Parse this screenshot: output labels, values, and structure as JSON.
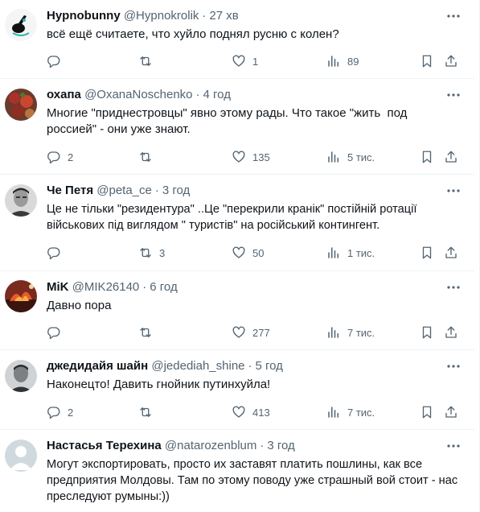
{
  "tweets": [
    {
      "name": "Hypnobunny",
      "handle": "@Hypnokrolik",
      "time": "27 хв",
      "text": "всё ещё считаете, что хуйло поднял русню с колен?",
      "replies": "",
      "retweets": "",
      "likes": "1",
      "views": "89"
    },
    {
      "name": "охапа",
      "handle": "@OxanaNoschenko",
      "time": "4 год",
      "text": "Многие \"приднестровцы\" явно этому рады. Что такое \"жить  под россией\" - они уже знают.",
      "replies": "2",
      "retweets": "",
      "likes": "135",
      "views": "5 тис."
    },
    {
      "name": "Че Петя",
      "handle": "@peta_ce",
      "time": "3 год",
      "text": "Це не тільки \"резидентура\" ..Це \"перекрили кранік\" постійній ротації військових під виглядом \" туристів\" на російський контингент.",
      "replies": "",
      "retweets": "3",
      "likes": "50",
      "views": "1 тис."
    },
    {
      "name": "MiK",
      "handle": "@MIK26140",
      "time": "6 год",
      "text": "Давно пора",
      "replies": "",
      "retweets": "",
      "likes": "277",
      "views": "7 тис."
    },
    {
      "name": "джедидайя шайн",
      "handle": "@jedediah_shine",
      "time": "5 год",
      "text": "Наконецто! Давить гнойник путинхуйла!",
      "replies": "2",
      "retweets": "",
      "likes": "413",
      "views": "7 тис."
    },
    {
      "name": "Настасья Терехина",
      "handle": "@natarozenblum",
      "time": "3 год",
      "text": "Могут экспортировать, просто их заставят платить пошлины, как все предприятия Молдовы. Там по этому поводу уже страшный вой стоит - нас преследуют румыны:))",
      "replies": "",
      "retweets": "",
      "likes": "",
      "views": ""
    }
  ],
  "icons": {
    "reply": "reply-icon",
    "retweet": "retweet-icon",
    "like": "heart-icon",
    "views": "views-chart-icon",
    "bookmark": "bookmark-icon",
    "share": "share-icon",
    "more": "more-dots-icon"
  },
  "colors": {
    "text_primary": "#0f1419",
    "text_secondary": "#536471",
    "divider": "#eff3f4"
  }
}
